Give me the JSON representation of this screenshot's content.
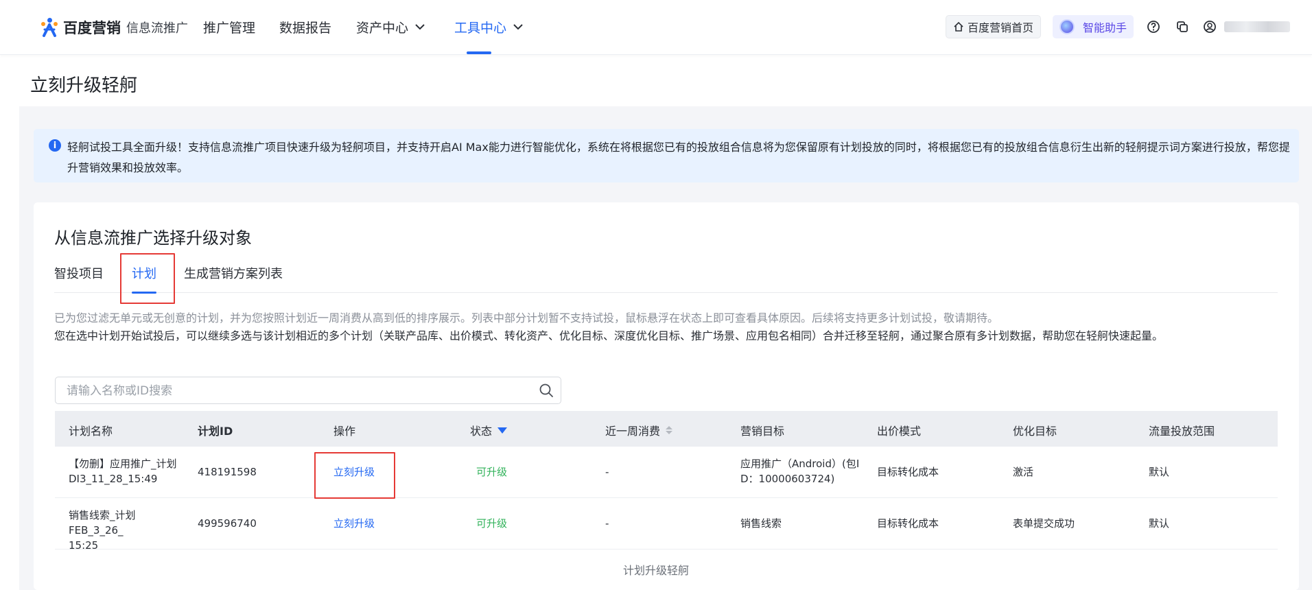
{
  "nav": {
    "brand_main": "百度营销",
    "brand_sub": "信息流推广",
    "items": [
      "推广管理",
      "数据报告",
      "资产中心",
      "工具中心"
    ],
    "home_btn": "百度营销首页",
    "ai_btn": "智能助手"
  },
  "page": {
    "title": "立刻升级轻舸"
  },
  "banner": {
    "text": "轻舸试投工具全面升级！支持信息流推广项目快速升级为轻舸项目，并支持开启AI Max能力进行智能优化，系统在将根据您已有的投放组合信息将为您保留原有计划投放的同时，将根据您已有的投放组合信息衍生出新的轻舸提示词方案进行投放，帮您提升营销效果和投放效率。"
  },
  "section": {
    "title": "从信息流推广选择升级对象",
    "tabs": [
      "智投项目",
      "计划",
      "生成营销方案列表"
    ],
    "desc_line1": "已为您过滤无单元或无创意的计划，并为您按照计划近一周消费从高到低的排序展示。列表中部分计划暂不支持试投，鼠标悬浮在状态上即可查看具体原因。后续将支持更多计划试投，敬请期待。",
    "desc_line2": "您在选中计划开始试投后，可以继续多选与该计划相近的多个计划（关联产品库、出价模式、转化资产、优化目标、深度优化目标、推广场景、应用包名相同）合并迁移至轻舸，通过聚合原有多计划数据，帮助您在轻舸快速起量。"
  },
  "search": {
    "placeholder": "请输入名称或ID搜索",
    "value": ""
  },
  "table": {
    "headers": [
      "计划名称",
      "计划ID",
      "操作",
      "状态",
      "近一周消费",
      "营销目标",
      "出价模式",
      "优化目标",
      "流量投放范围"
    ],
    "rows": [
      {
        "name": "【勿删】应用推广_计划DI3_11_28_15:49",
        "name_l1": "【勿删】应用推广_计划",
        "name_l2": "DI3_11_28_15:49",
        "id": "418191598",
        "action": "立刻升级",
        "status": "可升级",
        "spend": "-",
        "goal_l1": "应用推广（Android）(包I",
        "goal_l2": "D：10000603724)",
        "bid": "目标转化成本",
        "opt": "激活",
        "scope": "默认"
      },
      {
        "name": "销售线索_计划FEB_3_26_15:25",
        "name_l1": "销售线索_计划FEB_3_26_",
        "name_l2": "15:25",
        "id": "499596740",
        "action": "立刻升级",
        "status": "可升级",
        "spend": "-",
        "goal_l1": "销售线索",
        "goal_l2": "",
        "bid": "目标转化成本",
        "opt": "表单提交成功",
        "scope": "默认"
      }
    ]
  },
  "caption": "计划升级轻舸",
  "colors": {
    "primary": "#2468f2",
    "success": "#31b25a",
    "highlight": "#e53935",
    "banner_bg": "#e8f2ff"
  }
}
